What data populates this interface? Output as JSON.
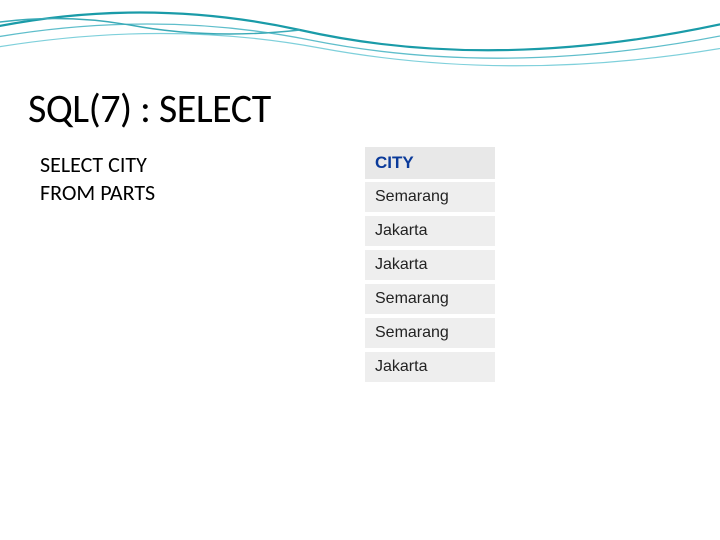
{
  "title": "SQL(7) : SELECT",
  "sql": {
    "line1": "SELECT CITY",
    "line2": "FROM PARTS"
  },
  "result": {
    "header": "CITY",
    "rows": [
      "Semarang",
      "Jakarta",
      "Jakarta",
      "Semarang",
      "Semarang",
      "Jakarta"
    ]
  }
}
